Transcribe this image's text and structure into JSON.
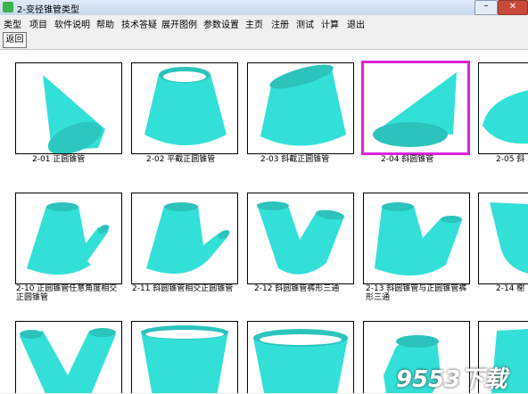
{
  "window": {
    "title": "2-变径锥管类型"
  },
  "menu": [
    "类型",
    "项目",
    "软件说明",
    "帮助",
    "技术答疑",
    "展开图例",
    "参数设置",
    "主页",
    "注册",
    "测试",
    "计算",
    "退出"
  ],
  "toolbar": {
    "back_label": "返回"
  },
  "items": [
    {
      "label": "2-01 正圆锥管",
      "icon": "cone-icon"
    },
    {
      "label": "2-02 平截正圆锥管",
      "icon": "truncated-cone-icon"
    },
    {
      "label": "2-03 斜截正圆锥管",
      "icon": "oblique-cut-cone-icon"
    },
    {
      "label": "2-04 斜圆锥管",
      "icon": "oblique-cone-icon",
      "selected": true
    },
    {
      "label": "2-05 斜",
      "icon": "cone-partial-icon"
    },
    {
      "label": "2-10 正圆锥管任意角度相交正圆锥管",
      "line1": "2-10 正圆锥管任意角度相交",
      "line2": "正圆锥管",
      "icon": "cone-branch-icon"
    },
    {
      "label": "2-11 斜圆锥管相交正圆锥管",
      "icon": "cone-branch-oblique-icon"
    },
    {
      "label": "2-12 斜圆锥管裤形三通",
      "icon": "trousers-tee-icon"
    },
    {
      "label": "2-13 斜圆锥管与正圆锥管裤形三通",
      "line1": "2-13 斜圆锥管与正圆锥管裤",
      "line2": "形三通",
      "icon": "mixed-tee-icon"
    },
    {
      "label": "2-14 榭",
      "icon": "cone-partial-icon"
    },
    {
      "label": "",
      "icon": "y-branch-icon"
    },
    {
      "label": "",
      "icon": "flared-pipe-icon"
    },
    {
      "label": "",
      "icon": "bowl-pipe-icon"
    },
    {
      "label": "",
      "icon": "bent-pipe-icon"
    },
    {
      "label": "",
      "icon": "pipe-partial-icon"
    }
  ],
  "watermark": "9553下载"
}
